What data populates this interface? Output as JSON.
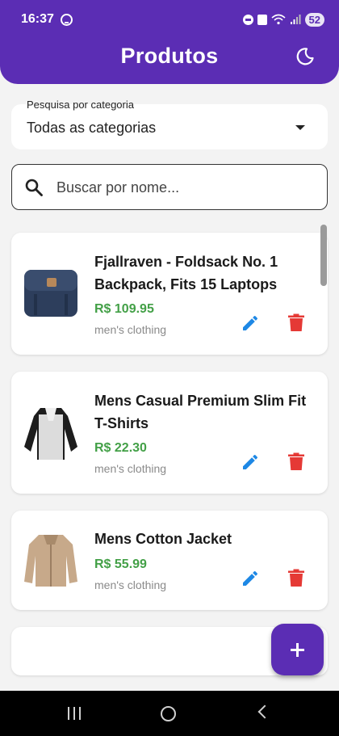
{
  "status": {
    "time": "16:37",
    "battery": "52"
  },
  "header": {
    "title": "Produtos"
  },
  "filter": {
    "label": "Pesquisa por categoria",
    "value": "Todas as categorias"
  },
  "search": {
    "placeholder": "Buscar por nome..."
  },
  "products": [
    {
      "name": "Fjallraven - Foldsack No. 1 Backpack, Fits 15 Laptops",
      "price": "R$ 109.95",
      "category": "men's clothing"
    },
    {
      "name": "Mens Casual Premium Slim Fit T-Shirts",
      "price": "R$ 22.30",
      "category": "men's clothing"
    },
    {
      "name": "Mens Cotton Jacket",
      "price": "R$ 55.99",
      "category": "men's clothing"
    }
  ],
  "colors": {
    "primary": "#5b2db4",
    "price": "#43a047",
    "edit": "#1e88e5",
    "delete": "#e53935"
  },
  "icons": [
    "download-icon",
    "moon-icon",
    "search-icon",
    "edit-icon",
    "delete-icon",
    "add-icon"
  ]
}
